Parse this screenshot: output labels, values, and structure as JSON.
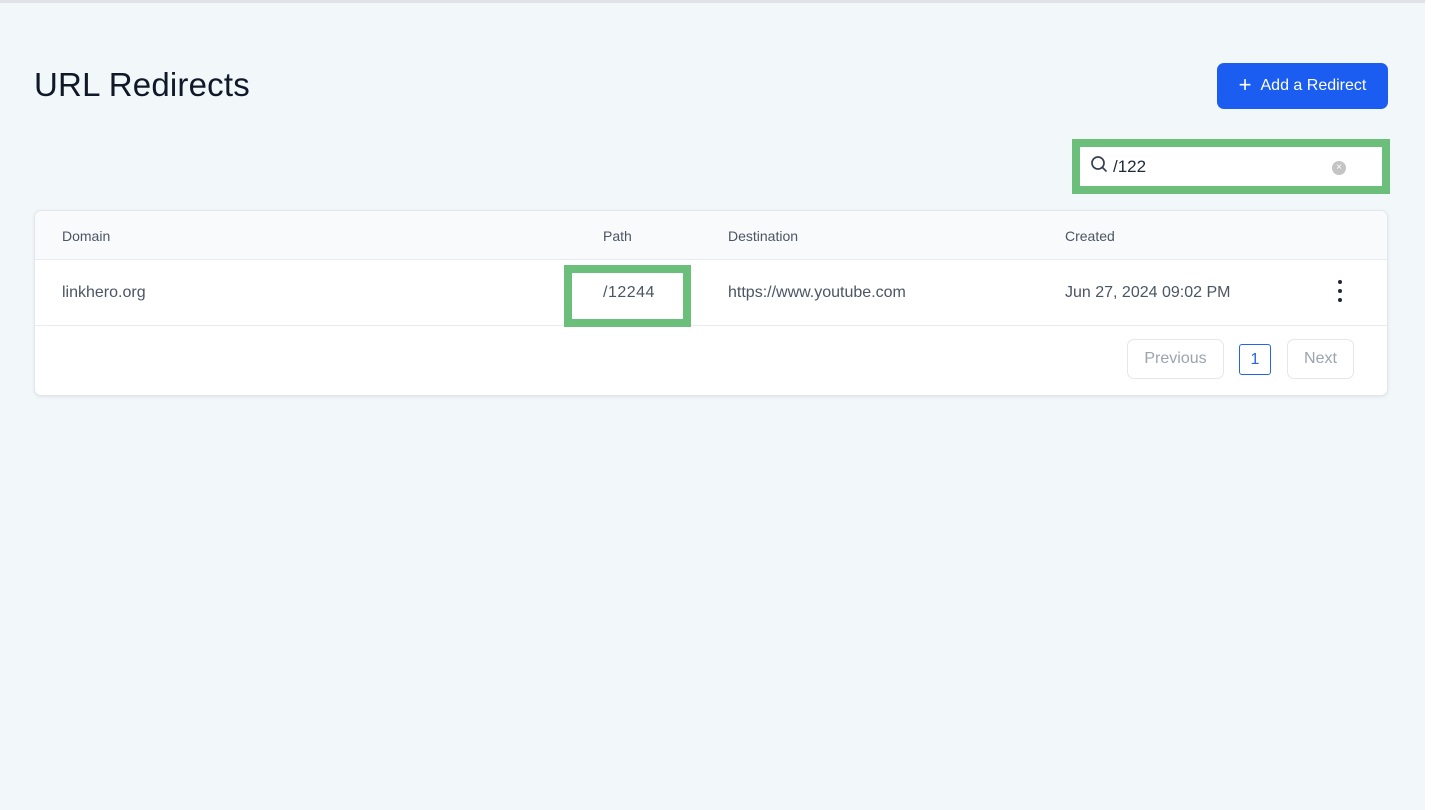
{
  "page": {
    "title": "URL Redirects",
    "add_button": "Add a Redirect",
    "add_icon": "plus-icon"
  },
  "search": {
    "value": "/122",
    "icon": "search-icon",
    "clear_icon": "clear-icon"
  },
  "table": {
    "columns": [
      "Domain",
      "Path",
      "Destination",
      "Created"
    ],
    "rows": [
      {
        "domain": "linkhero.org",
        "path": "/12244",
        "destination": "https://www.youtube.com",
        "created": "Jun 27, 2024 09:02 PM"
      }
    ]
  },
  "pagination": {
    "previous": "Previous",
    "current": "1",
    "next": "Next"
  },
  "colors": {
    "accent": "#1a5df0",
    "highlight": "#6cbf7b",
    "background": "#f2f7fa"
  }
}
